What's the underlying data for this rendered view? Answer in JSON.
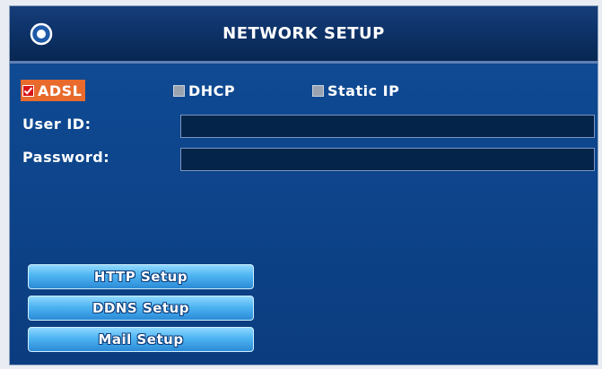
{
  "window": {
    "title": "NETWORK SETUP",
    "icon": "power-icon"
  },
  "connection_type": {
    "options": [
      {
        "label": "ADSL",
        "checked": true
      },
      {
        "label": "DHCP",
        "checked": false
      },
      {
        "label": "Static IP",
        "checked": false
      }
    ]
  },
  "form": {
    "user_id_label": "User ID:",
    "user_id_value": "",
    "password_label": "Password:",
    "password_value": ""
  },
  "buttons": {
    "http_setup": "HTTP Setup",
    "ddns_setup": "DDNS Setup",
    "mail_setup": "Mail Setup"
  },
  "colors": {
    "background": "#0c3f80",
    "title_bar": "#0e3269",
    "selected_option": "#e86a2d",
    "button": "#4db4f2",
    "field": "#05244a"
  }
}
